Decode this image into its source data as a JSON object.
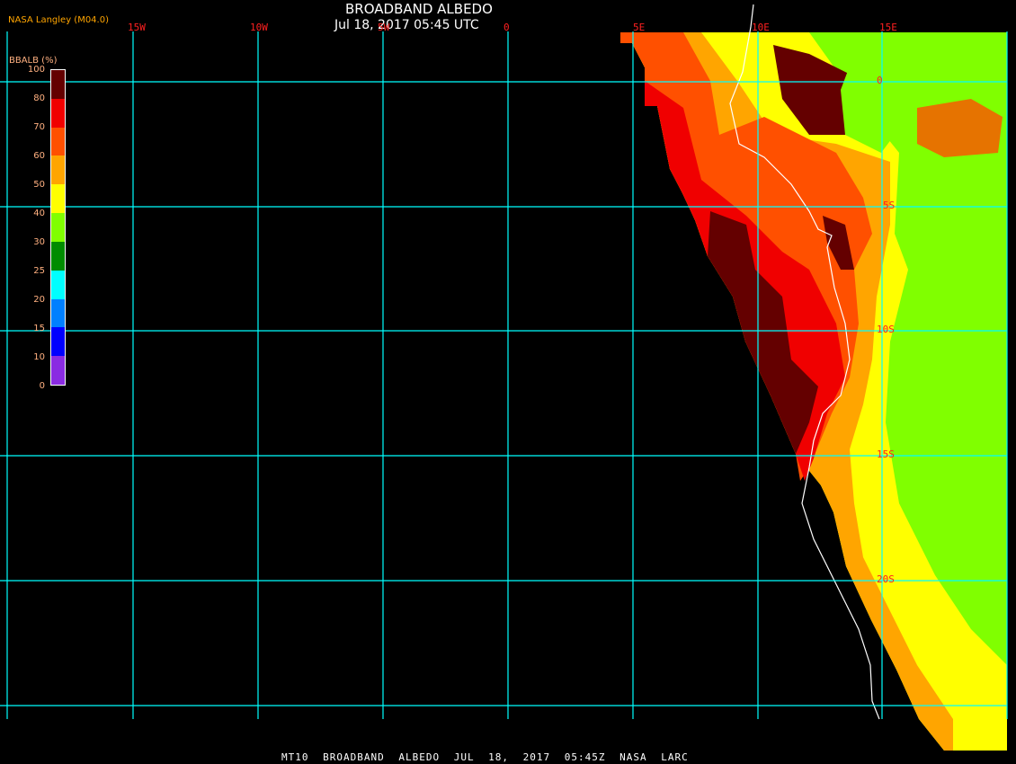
{
  "header": {
    "title": "BROADBAND ALBEDO",
    "datetime": "Jul 18, 2017 05:45 UTC",
    "credit": "NASA Langley (M04.0)"
  },
  "map": {
    "longitude_labels": [
      "15W",
      "10W",
      "5W",
      "0",
      "5E",
      "10E",
      "15E"
    ],
    "latitude_labels": [
      "0",
      "5S",
      "10S",
      "15S",
      "20S"
    ],
    "grid_color": "#00ffff",
    "coastline_color": "#ffffff"
  },
  "legend": {
    "title": "BBALB (%)",
    "ticks": [
      "100",
      "80",
      "70",
      "60",
      "50",
      "40",
      "30",
      "25",
      "20",
      "15",
      "10",
      "0"
    ],
    "colors": [
      "#640000",
      "#f00000",
      "#ff5000",
      "#ffa500",
      "#ffff00",
      "#80ff00",
      "#008c00",
      "#00ffff",
      "#0080ff",
      "#0000ff",
      "#8a2be2"
    ]
  },
  "footer": {
    "text": "MT10  BROADBAND ALBEDO   JUL 18, 2017 05:45Z   NASA LARC"
  }
}
